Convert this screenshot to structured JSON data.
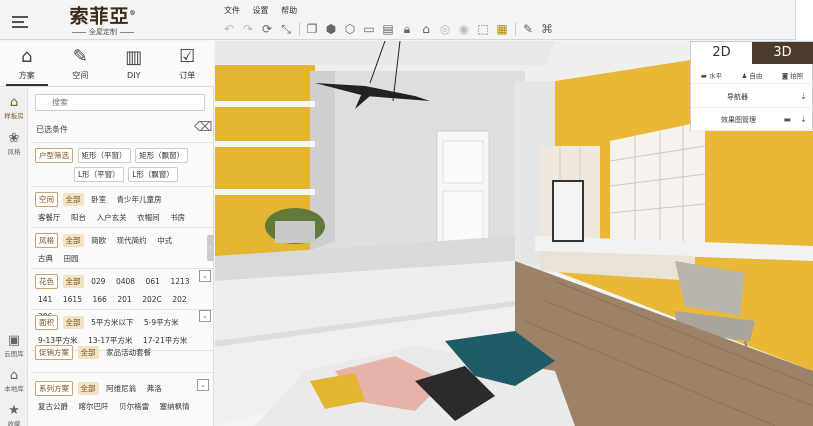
{
  "app": {
    "logo_name": "索菲亞",
    "logo_mark": "®",
    "logo_sub": "全屋定制"
  },
  "menu": [
    "文件",
    "设置",
    "帮助"
  ],
  "toolbar_icons": [
    "undo-icon",
    "redo-icon",
    "rotate-icon",
    "measure-icon",
    "copy-icon",
    "group-icon",
    "ungroup-icon",
    "frame-icon",
    "cabinet-icon",
    "lock-icon",
    "unlock-icon",
    "hide-icon",
    "show-icon",
    "box-icon",
    "texture-icon",
    "brush-icon",
    "material-icon"
  ],
  "tabs": [
    {
      "label": "方案",
      "icon": "house-icon",
      "active": true
    },
    {
      "label": "空间",
      "icon": "edit-icon",
      "active": false
    },
    {
      "label": "DIY",
      "icon": "diy-icon",
      "active": false
    },
    {
      "label": "订单",
      "icon": "order-icon",
      "active": false
    }
  ],
  "sidenav": [
    {
      "label": "样板房",
      "icon": "home-icon",
      "active": true
    },
    {
      "label": "风格",
      "icon": "palette-icon",
      "active": false
    },
    {
      "label": "云图库",
      "icon": "gallery-icon",
      "active": false
    },
    {
      "label": "本地库",
      "icon": "local-home-icon",
      "active": false
    },
    {
      "label": "收藏",
      "icon": "star-icon",
      "active": false
    }
  ],
  "search": {
    "placeholder": "搜索"
  },
  "selected_label": "已选条件",
  "groups": {
    "house_type": {
      "header": "户型筛选",
      "rows": [
        [
          "矩形（平窗）",
          "矩形（飘窗）"
        ],
        [
          "L形（平窗）",
          "L形（飘窗）"
        ]
      ]
    },
    "space": {
      "header": "空间",
      "all": "全部",
      "items": [
        "卧室",
        "青少年儿童房",
        "客餐厅",
        "阳台",
        "入户玄关",
        "衣帽间",
        "书房"
      ]
    },
    "style": {
      "header": "风格",
      "all": "全部",
      "items": [
        "简欧",
        "现代简约",
        "中式",
        "古典",
        "田园"
      ]
    },
    "color": {
      "header": "花色",
      "all": "全部",
      "items": [
        "029",
        "0408",
        "061",
        "1213",
        "141",
        "1615",
        "166",
        "201",
        "202C",
        "202",
        "206"
      ]
    },
    "area": {
      "header": "面积",
      "all": "全部",
      "items": [
        "5平方米以下",
        "5-9平方米",
        "9-13平方米",
        "13-17平方米",
        "17-21平方米"
      ]
    },
    "promo": {
      "header": "促销方案",
      "all": "全部",
      "items": [
        "家品活动套餐"
      ]
    },
    "series": {
      "header": "系列方案",
      "all": "全部",
      "items": [
        "阿维尼翁",
        "弗洛",
        "复古公爵",
        "喀尔巴阡",
        "贝尔格雷",
        "塞纳枫情"
      ]
    }
  },
  "view_panel": {
    "btn_2d": "2D",
    "btn_3d": "3D",
    "cams": [
      "水平",
      "自由",
      "拍照"
    ],
    "navigator": "导航器",
    "effect_manager": "效果图管理"
  },
  "colors": {
    "accent_brown": "#4a3b2c",
    "wall_yellow": "#e3b531",
    "chip_border": "#c9a46c"
  }
}
